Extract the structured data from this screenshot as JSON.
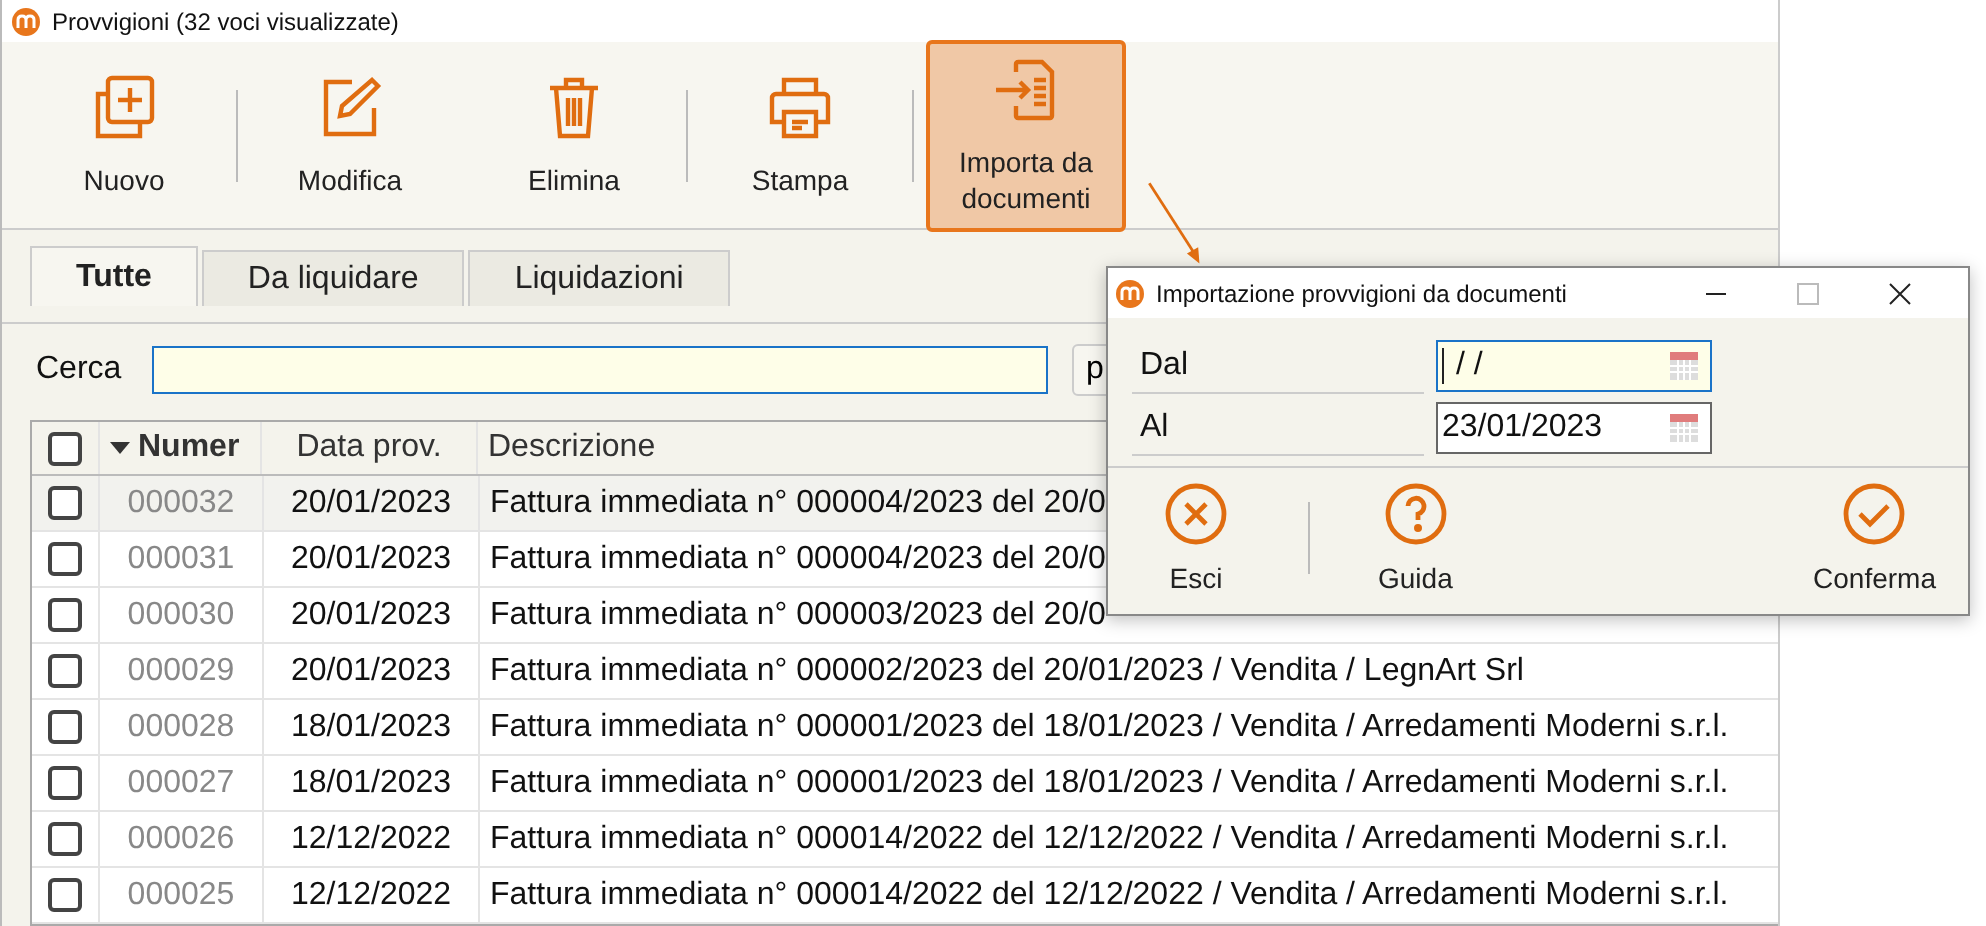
{
  "window": {
    "title": "Provvigioni (32 voci visualizzate)"
  },
  "toolbar": [
    {
      "label": "Nuovo",
      "kind": "new",
      "separator": false,
      "selected": false
    },
    {
      "label": "Modifica",
      "kind": "edit",
      "separator": true,
      "selected": false
    },
    {
      "label": "Elimina",
      "kind": "delete",
      "separator": false,
      "selected": false
    },
    {
      "label": "Stampa",
      "kind": "print",
      "separator": true,
      "selected": false
    },
    {
      "label": "Importa da documenti",
      "kind": "import",
      "separator": true,
      "selected": true
    }
  ],
  "tabs": [
    {
      "label": "Tutte",
      "selected": true
    },
    {
      "label": "Da liquidare",
      "selected": false
    },
    {
      "label": "Liquidazioni",
      "selected": false
    }
  ],
  "search": {
    "label": "Cerca",
    "button": "p"
  },
  "table": {
    "select_all": {
      "checked": false
    },
    "columns": [
      {
        "label": "Numer",
        "sorted": true
      },
      {
        "label": "Data prov.",
        "sorted": false
      },
      {
        "label": "Descrizione",
        "sorted": false
      }
    ],
    "rows": [
      {
        "checked": false,
        "selected": true,
        "number": "000032",
        "date": "20/01/2023",
        "description": "Fattura immediata n° 000004/2023 del 20/0"
      },
      {
        "checked": false,
        "selected": false,
        "number": "000031",
        "date": "20/01/2023",
        "description": "Fattura immediata n° 000004/2023 del 20/0"
      },
      {
        "checked": false,
        "selected": false,
        "number": "000030",
        "date": "20/01/2023",
        "description": "Fattura immediata n° 000003/2023 del 20/0"
      },
      {
        "checked": false,
        "selected": false,
        "number": "000029",
        "date": "20/01/2023",
        "description": "Fattura immediata n° 000002/2023 del 20/01/2023 / Vendita / LegnArt Srl"
      },
      {
        "checked": false,
        "selected": false,
        "number": "000028",
        "date": "18/01/2023",
        "description": "Fattura immediata n° 000001/2023 del 18/01/2023 / Vendita / Arredamenti Moderni s.r.l."
      },
      {
        "checked": false,
        "selected": false,
        "number": "000027",
        "date": "18/01/2023",
        "description": "Fattura immediata n° 000001/2023 del 18/01/2023 / Vendita / Arredamenti Moderni s.r.l."
      },
      {
        "checked": false,
        "selected": false,
        "number": "000026",
        "date": "12/12/2022",
        "description": "Fattura immediata n° 000014/2022 del 12/12/2022 / Vendita / Arredamenti Moderni s.r.l."
      },
      {
        "checked": false,
        "selected": false,
        "number": "000025",
        "date": "12/12/2022",
        "description": "Fattura immediata n° 000014/2022 del 12/12/2022 / Vendita / Arredamenti Moderni s.r.l."
      }
    ]
  },
  "dialog": {
    "title": "Importazione provvigioni da documenti",
    "fields": [
      {
        "label": "Dal",
        "value": "/ /",
        "focused": true
      },
      {
        "label": "Al",
        "value": "23/01/2023",
        "focused": false
      }
    ],
    "buttons": [
      {
        "label": "Esci",
        "kind": "close",
        "separator": false
      },
      {
        "label": "Guida",
        "kind": "help",
        "separator": true
      },
      {
        "label": "Conferma",
        "kind": "confirm",
        "separator": false
      }
    ]
  }
}
